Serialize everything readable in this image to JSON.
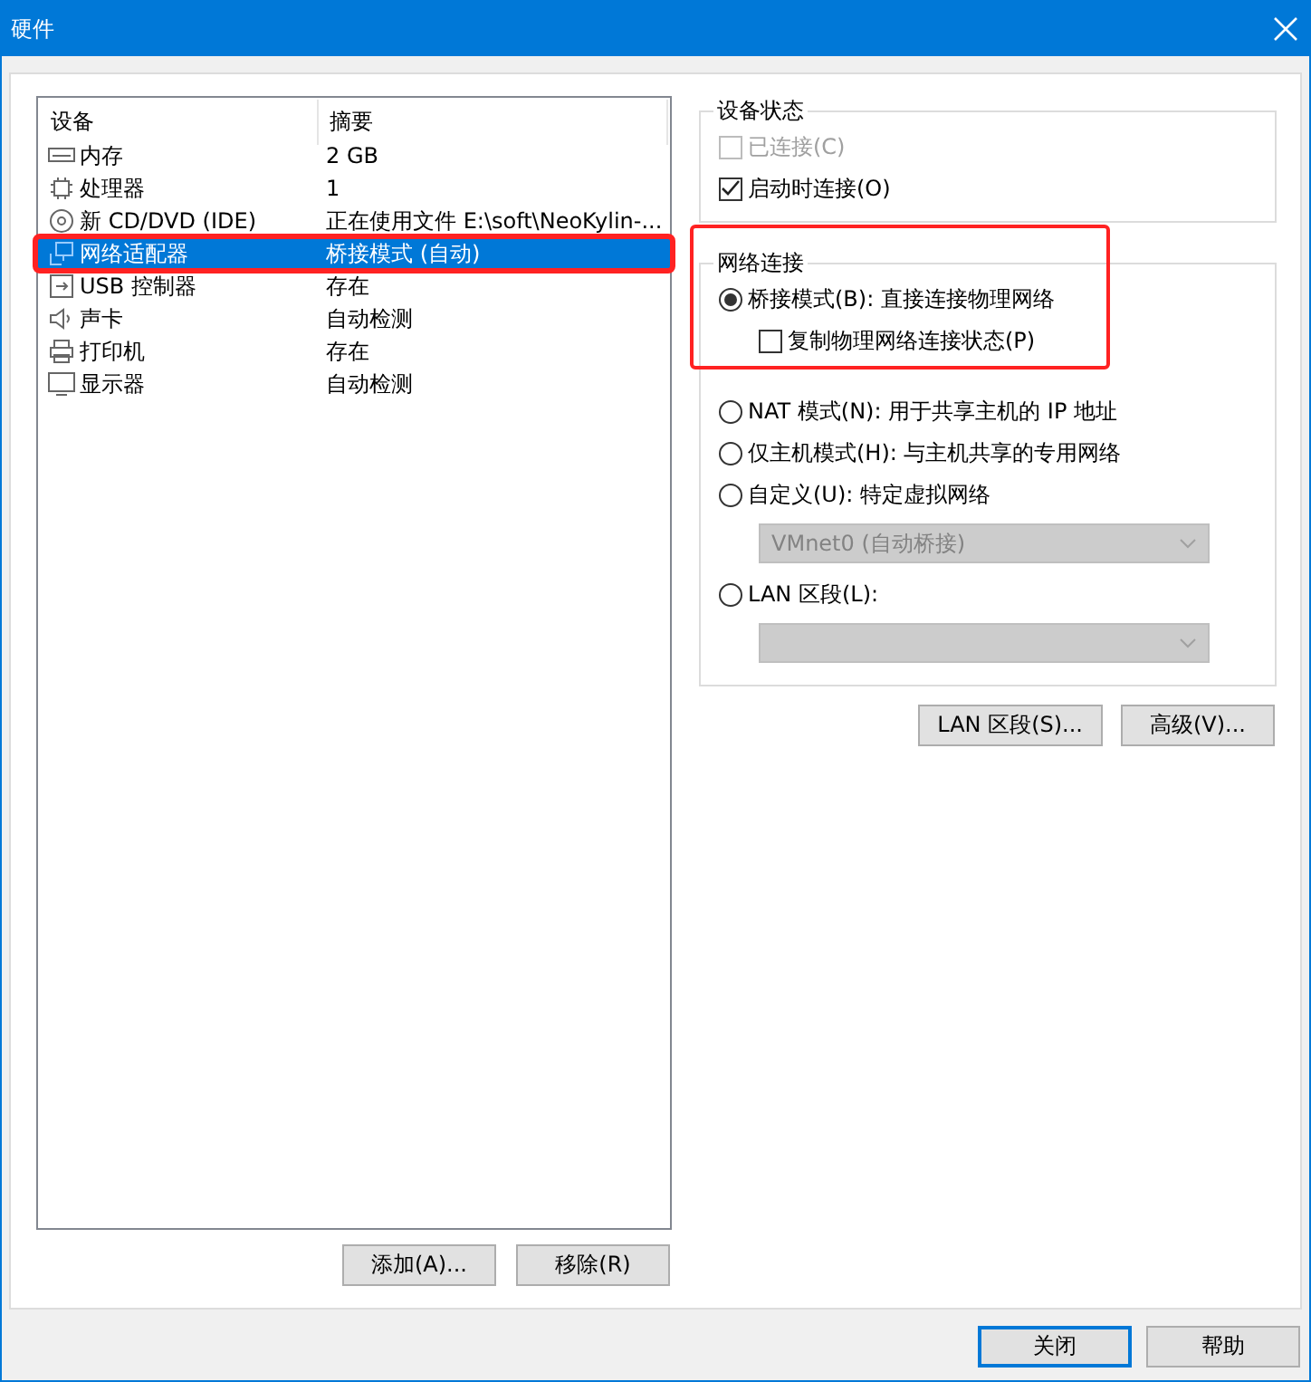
{
  "window": {
    "title": "硬件"
  },
  "device_table": {
    "columns": [
      "设备",
      "摘要"
    ],
    "rows": [
      {
        "kind": "memory",
        "device": "内存",
        "summary": "2 GB",
        "selected": false,
        "highlighted": false
      },
      {
        "kind": "cpu",
        "device": "处理器",
        "summary": "1",
        "selected": false,
        "highlighted": false
      },
      {
        "kind": "disc",
        "device": "新 CD/DVD (IDE)",
        "summary": "正在使用文件 E:\\soft\\NeoKylin-...",
        "selected": false,
        "highlighted": false
      },
      {
        "kind": "network",
        "device": "网络适配器",
        "summary": "桥接模式 (自动)",
        "selected": true,
        "highlighted": true
      },
      {
        "kind": "usb",
        "device": "USB 控制器",
        "summary": "存在",
        "selected": false,
        "highlighted": false
      },
      {
        "kind": "sound",
        "device": "声卡",
        "summary": "自动检测",
        "selected": false,
        "highlighted": false
      },
      {
        "kind": "printer",
        "device": "打印机",
        "summary": "存在",
        "selected": false,
        "highlighted": false
      },
      {
        "kind": "display",
        "device": "显示器",
        "summary": "自动检测",
        "selected": false,
        "highlighted": false
      }
    ]
  },
  "device_buttons": [
    "添加(A)...",
    "移除(R)"
  ],
  "device_status": {
    "title": "设备状态",
    "options": [
      {
        "label": "已连接(C)",
        "checked": false,
        "disabled": true
      },
      {
        "label": "启动时连接(O)",
        "checked": true,
        "disabled": false
      }
    ]
  },
  "network": {
    "title": "网络连接",
    "highlighted": true,
    "bridged": {
      "label": "桥接模式(B): 直接连接物理网络",
      "selected": true
    },
    "replicate": {
      "label": "复制物理网络连接状态(P)",
      "checked": false
    },
    "options": [
      {
        "kind": "radio",
        "label": "NAT 模式(N): 用于共享主机的 IP 地址",
        "selected": false
      },
      {
        "kind": "radio",
        "label": "仅主机模式(H): 与主机共享的专用网络",
        "selected": false
      },
      {
        "kind": "radio",
        "label": "自定义(U): 特定虚拟网络",
        "selected": false
      },
      {
        "kind": "select",
        "value": "VMnet0 (自动桥接)",
        "disabled": true
      },
      {
        "kind": "radio",
        "label": "LAN 区段(L):",
        "selected": false
      },
      {
        "kind": "select",
        "disabled": true
      }
    ]
  },
  "network_buttons": [
    "LAN 区段(S)...",
    "高级(V)..."
  ],
  "footer_buttons": [
    {
      "label": "关闭",
      "default": true
    },
    {
      "label": "帮助",
      "default": false
    }
  ]
}
